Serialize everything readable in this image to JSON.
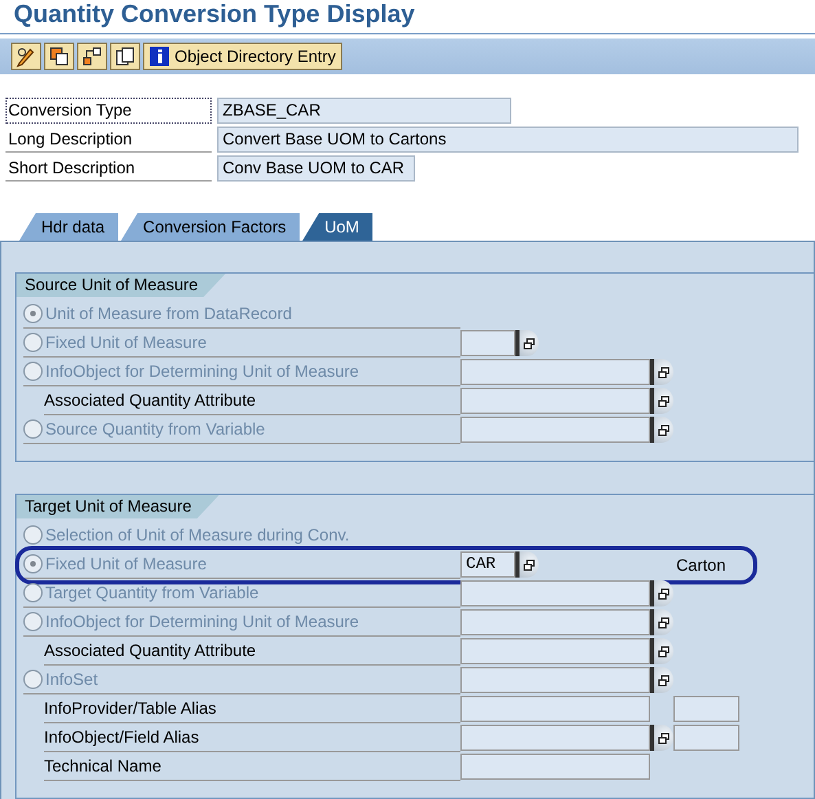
{
  "title": "Quantity Conversion Type Display",
  "toolbar": {
    "icon_buttons": [
      {
        "kind": "pencil"
      },
      {
        "kind": "change"
      },
      {
        "kind": "hierarchy"
      },
      {
        "kind": "copy"
      }
    ],
    "text_button": "Object Directory Entry"
  },
  "header_fields": [
    {
      "label": "Conversion Type",
      "value": "ZBASE_CAR"
    },
    {
      "label": "Long Description",
      "value": "Convert Base UOM to Cartons"
    },
    {
      "label": "Short Description",
      "value": "Conv Base UOM to CAR"
    }
  ],
  "tabs": [
    {
      "label": "Hdr data",
      "selected": false
    },
    {
      "label": "Conversion Factors",
      "selected": false
    },
    {
      "label": "UoM",
      "selected": true
    }
  ],
  "groups": [
    {
      "title": "Source Unit of Measure",
      "rows": [
        {
          "kind": "radio",
          "label": "Unit of Measure from DataRecord",
          "selected": true
        },
        {
          "kind": "radio",
          "label": "Fixed Unit of Measure",
          "selected": false,
          "field": {
            "kind": "short",
            "f4": true
          }
        },
        {
          "kind": "radio",
          "label": "InfoObject for Determining Unit of Measure",
          "selected": false,
          "field": {
            "kind": "long",
            "f4": true
          }
        },
        {
          "kind": "label",
          "label": "Associated Quantity Attribute",
          "field": {
            "kind": "long",
            "f4": true
          }
        },
        {
          "kind": "radio",
          "label": "Source Quantity from Variable",
          "selected": false,
          "field": {
            "kind": "long",
            "f4": true
          }
        }
      ]
    },
    {
      "title": "Target Unit of Measure",
      "rows": [
        {
          "kind": "radio",
          "label": "Selection of Unit of Measure during Conv.",
          "selected": false
        },
        {
          "kind": "radio",
          "label": "Fixed Unit of Measure",
          "selected": true,
          "field": {
            "kind": "short",
            "value": "CAR",
            "f4": true
          },
          "description": "Carton",
          "highlighted": true
        },
        {
          "kind": "radio",
          "label": "Target Quantity from Variable",
          "selected": false,
          "field": {
            "kind": "long",
            "f4": true
          }
        },
        {
          "kind": "radio",
          "label": "InfoObject for Determining Unit of Measure",
          "selected": false,
          "field": {
            "kind": "long",
            "f4": true
          }
        },
        {
          "kind": "label",
          "label": "Associated Quantity Attribute",
          "field": {
            "kind": "long",
            "f4": true
          }
        },
        {
          "kind": "radio",
          "label": "InfoSet",
          "selected": false,
          "field": {
            "kind": "long",
            "f4": true
          }
        },
        {
          "kind": "label",
          "label": "InfoProvider/Table Alias",
          "field": {
            "kind": "long",
            "f4": false,
            "extra_field": true
          }
        },
        {
          "kind": "label",
          "label": "InfoObject/Field Alias",
          "field": {
            "kind": "long",
            "f4": true,
            "extra_field": true
          }
        },
        {
          "kind": "label",
          "label": "Technical Name",
          "field": {
            "kind": "long",
            "f4": false
          }
        }
      ]
    }
  ]
}
